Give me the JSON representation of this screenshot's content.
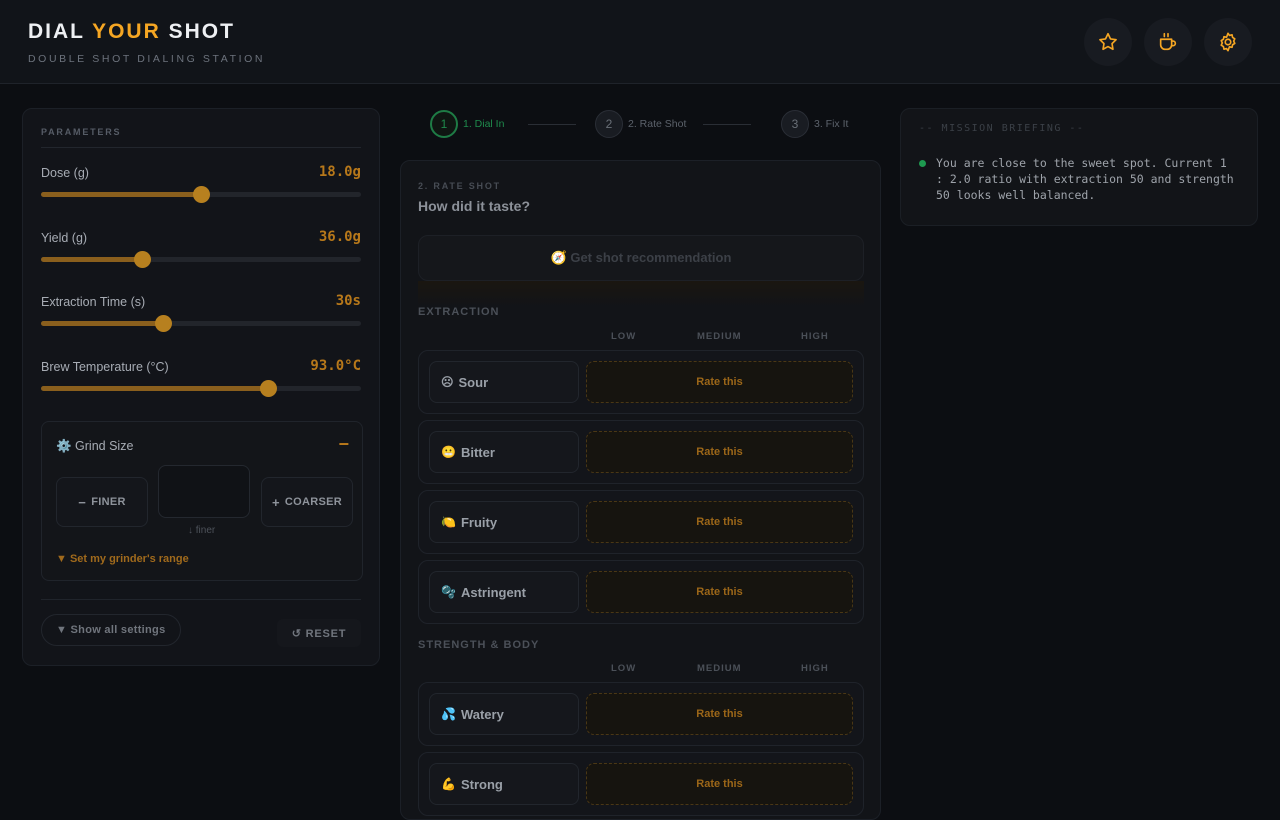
{
  "header": {
    "title_part1": "DIAL ",
    "title_accent": "YOUR",
    "title_part2": " SHOT",
    "subtitle": "DOUBLE SHOT DIALING STATION",
    "icons": [
      "star-icon",
      "coffee-cup-icon",
      "gear-icon"
    ],
    "accent_color": "#f5a623"
  },
  "parameters": {
    "section_label": "PARAMETERS",
    "items": [
      {
        "name": "Dose (g)",
        "value": "18.0g",
        "level": 0.5
      },
      {
        "name": "Yield (g)",
        "value": "36.0g",
        "level": 0.315
      },
      {
        "name": "Extraction Time (s)",
        "value": "30s",
        "level": 0.38
      },
      {
        "name": "Brew Temperature (°C)",
        "value": "93.0°C",
        "level": 0.71
      }
    ],
    "grind": {
      "title": "⚙️ Grind Size",
      "collapse_symbol": "−",
      "finer_label": "FINER",
      "finer_symbol": "−",
      "coarser_label": "COARSER",
      "coarser_symbol": "+",
      "hint": "↓ finer",
      "range_link": "▼ Set my grinder's range"
    },
    "show_all": "▼ Show all settings",
    "reset": "↺ RESET"
  },
  "steps": [
    {
      "num": "1",
      "label": "1. Dial In",
      "active": true
    },
    {
      "num": "2",
      "label": "2. Rate Shot",
      "active": false
    },
    {
      "num": "3",
      "label": "3. Fix It",
      "active": false
    }
  ],
  "rate": {
    "section_label": "2. RATE SHOT",
    "title": "How did it taste?",
    "recommend_button": "🧭 Get shot recommendation",
    "columns": [
      "LOW",
      "MEDIUM",
      "HIGH"
    ],
    "rate_label": "Rate this",
    "categories": [
      {
        "title": "EXTRACTION",
        "rows": [
          {
            "emoji": "☹",
            "name": "Sour"
          },
          {
            "emoji": "😬",
            "name": "Bitter"
          },
          {
            "emoji": "🍋",
            "name": "Fruity"
          },
          {
            "emoji": "🫧",
            "name": "Astringent"
          }
        ]
      },
      {
        "title": "STRENGTH & BODY",
        "rows": [
          {
            "emoji": "💦",
            "name": "Watery"
          },
          {
            "emoji": "💪",
            "name": "Strong"
          }
        ]
      }
    ]
  },
  "briefing": {
    "label": "-- MISSION BRIEFING --",
    "text": "You are close to the sweet spot. Current 1 : 2.0 ratio with extraction 50 and strength 50 looks well balanced.",
    "status_color": "#1e9a50"
  }
}
